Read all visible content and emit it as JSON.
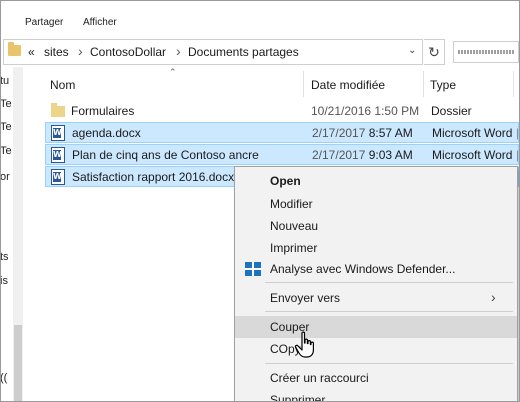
{
  "ribbon": {
    "tabs": [
      "Partager",
      "Afficher"
    ]
  },
  "address": {
    "back_glyph": "«",
    "crumbs": [
      "sites",
      "ContosoDollar",
      "Documents partages"
    ]
  },
  "nav_fragments": [
    "tu",
    "Te",
    "Te",
    "Te",
    "or",
    "ts",
    "is",
    "(("
  ],
  "columns": {
    "name": "Nom",
    "date": "Date modifiée",
    "type": "Type"
  },
  "files": [
    {
      "name": "Formulaires",
      "date": "10/21/2016 1:50 PM",
      "time": "",
      "type": "Dossier",
      "icon": "folder-icon",
      "selected": false
    },
    {
      "name": "agenda.docx",
      "date": "2/17/2017 ",
      "time": "8:57 AM",
      "type": "Microsoft Word",
      "icon": "word-document-icon",
      "selected": true
    },
    {
      "name": "Plan de cinq ans de Contoso ancre",
      "date": "2/17/2017 ",
      "time": "9:03 AM",
      "type": "Microsoft Word",
      "icon": "word-document-icon",
      "selected": true
    },
    {
      "name": "Satisfaction rapport 2016.docx",
      "date": "",
      "time": "",
      "type": "",
      "icon": "word-document-icon",
      "selected": true
    }
  ],
  "context_menu": {
    "items": [
      "Open",
      "Modifier",
      "Nouveau",
      "Imprimer",
      "Analyse avec Windows Defender...",
      "Envoyer vers",
      "Couper",
      "COpy",
      "Créer un raccourci",
      "Supprimer"
    ]
  },
  "colors": {
    "selection": "#cce8ff",
    "selection_border": "#99d1ff",
    "menu_bg": "#f2f2f2",
    "menu_hover": "#d9d9d9",
    "word_blue": "#2b5797"
  }
}
